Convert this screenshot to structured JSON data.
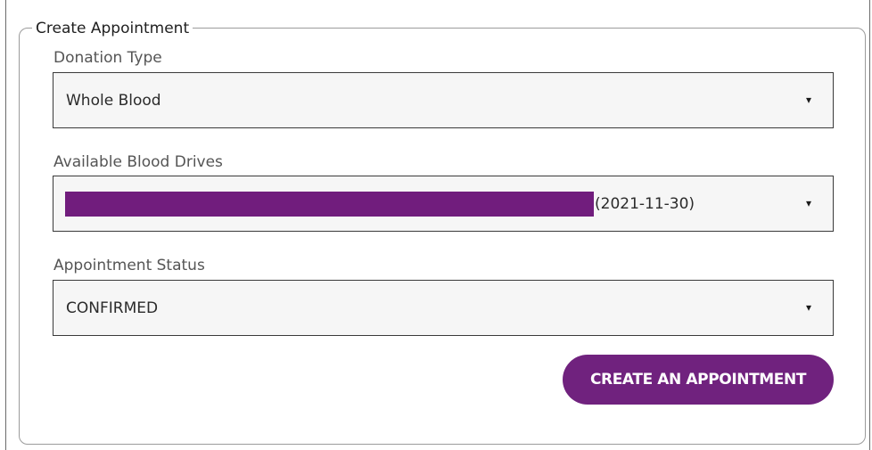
{
  "form": {
    "legend": "Create Appointment",
    "donation_type": {
      "label": "Donation Type",
      "value": "Whole Blood"
    },
    "blood_drives": {
      "label": "Available Blood Drives",
      "value_date": "(2021-11-30)"
    },
    "appointment_status": {
      "label": "Appointment Status",
      "value": "CONFIRMED"
    },
    "caret_glyph": "▾",
    "create_button_label": "CREATE AN APPOINTMENT"
  },
  "colors": {
    "accent": "#70227e",
    "redaction": "#711d7d",
    "border": "#9b9b9b",
    "field_background": "#f6f6f6"
  },
  "icons": {
    "dropdown": "caret-down-icon"
  }
}
